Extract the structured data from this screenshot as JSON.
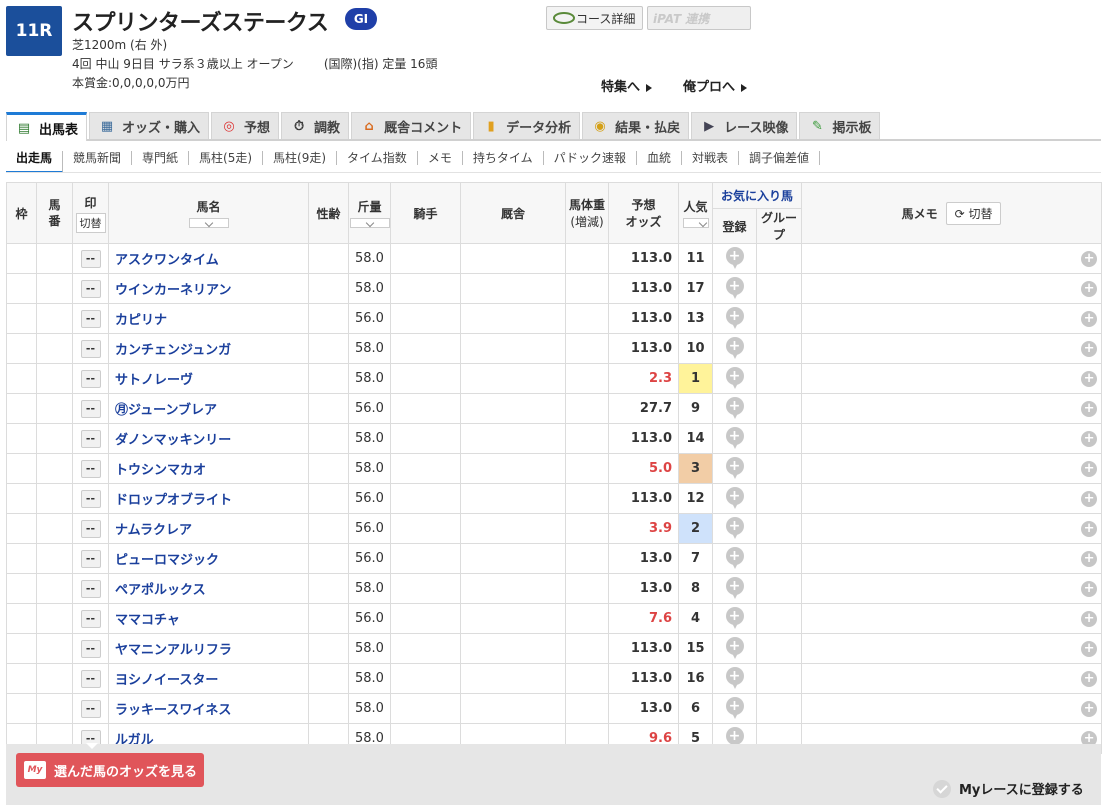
{
  "race": {
    "number": "11R",
    "name": "スプリンターズステークス",
    "grade": "GI",
    "course": "芝1200m (右 外)",
    "meeting": "4回 中山 9日目 サラ系３歳以上 オープン",
    "conditions": "(国際)(指) 定量 16頭",
    "prize": "本賞金:0,0,0,0,0万円"
  },
  "top_buttons": {
    "course_detail": "コース詳細",
    "ipat": "iPAT 連携"
  },
  "links": {
    "special": "特集へ",
    "pro": "俺プロへ"
  },
  "tabs": [
    {
      "label": "出馬表",
      "icon": "table-icon",
      "active": true
    },
    {
      "label": "オッズ・購入",
      "icon": "odds-icon"
    },
    {
      "label": "予想",
      "icon": "target-icon"
    },
    {
      "label": "調教",
      "icon": "stopwatch-icon"
    },
    {
      "label": "厩舎コメント",
      "icon": "stable-icon"
    },
    {
      "label": "データ分析",
      "icon": "bar-chart-icon"
    },
    {
      "label": "結果・払戻",
      "icon": "coins-icon"
    },
    {
      "label": "レース映像",
      "icon": "video-icon"
    },
    {
      "label": "掲示板",
      "icon": "chat-icon"
    }
  ],
  "subtabs": [
    "出走馬",
    "競馬新聞",
    "専門紙",
    "馬柱(5走)",
    "馬柱(9走)",
    "タイム指数",
    "メモ",
    "持ちタイム",
    "パドック速報",
    "血統",
    "対戦表",
    "調子偏差値"
  ],
  "columns": {
    "waku": "枠",
    "umaban": "馬番",
    "mark": "印",
    "mark_toggle": "切替",
    "name": "馬名",
    "sex_age": "性齢",
    "weight": "斤量",
    "jockey": "騎手",
    "stable": "厩舎",
    "body_weight": "馬体重",
    "body_weight_sub": "(増減)",
    "odds": "予想",
    "odds_sub": "オッズ",
    "popularity": "人気",
    "favorite": "お気に入り馬",
    "fav_register": "登録",
    "fav_group": "グループ",
    "memo": "馬メモ",
    "memo_toggle": "切替"
  },
  "mark_placeholder": "--",
  "horses": [
    {
      "name": "アスクワンタイム",
      "weight": "58.0",
      "odds": "113.0",
      "pop": "11"
    },
    {
      "name": "ウインカーネリアン",
      "weight": "58.0",
      "odds": "113.0",
      "pop": "17"
    },
    {
      "name": "カピリナ",
      "weight": "56.0",
      "odds": "113.0",
      "pop": "13"
    },
    {
      "name": "カンチェンジュンガ",
      "weight": "58.0",
      "odds": "113.0",
      "pop": "10"
    },
    {
      "name": "サトノレーヴ",
      "weight": "58.0",
      "odds": "2.3",
      "pop": "1"
    },
    {
      "name": "㊊ジューンブレア",
      "weight": "56.0",
      "odds": "27.7",
      "pop": "9"
    },
    {
      "name": "ダノンマッキンリー",
      "weight": "58.0",
      "odds": "113.0",
      "pop": "14"
    },
    {
      "name": "トウシンマカオ",
      "weight": "58.0",
      "odds": "5.0",
      "pop": "3"
    },
    {
      "name": "ドロップオブライト",
      "weight": "56.0",
      "odds": "113.0",
      "pop": "12"
    },
    {
      "name": "ナムラクレア",
      "weight": "56.0",
      "odds": "3.9",
      "pop": "2"
    },
    {
      "name": "ピューロマジック",
      "weight": "56.0",
      "odds": "13.0",
      "pop": "7"
    },
    {
      "name": "ペアポルックス",
      "weight": "58.0",
      "odds": "13.0",
      "pop": "8"
    },
    {
      "name": "ママコチャ",
      "weight": "56.0",
      "odds": "7.6",
      "pop": "4"
    },
    {
      "name": "ヤマニンアルリフラ",
      "weight": "58.0",
      "odds": "113.0",
      "pop": "15"
    },
    {
      "name": "ヨシノイースター",
      "weight": "58.0",
      "odds": "113.0",
      "pop": "16"
    },
    {
      "name": "ラッキースワイネス",
      "weight": "58.0",
      "odds": "13.0",
      "pop": "6"
    },
    {
      "name": "ルガル",
      "weight": "58.0",
      "odds": "9.6",
      "pop": "5"
    }
  ],
  "bottom": {
    "odds_button": "選んだ馬のオッズを見る",
    "my_label": "My",
    "my_race": "Myレースに登録する"
  },
  "colors": {
    "accent_blue": "#1b4f9b",
    "odds_red": "#d44444",
    "pop1": "#fff39a",
    "pop2": "#cfe2fb",
    "pop3": "#f2cda6",
    "button_red": "#e0555a"
  }
}
